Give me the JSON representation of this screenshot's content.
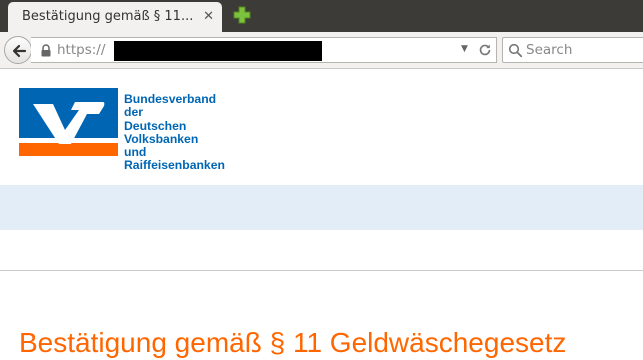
{
  "browser": {
    "tab_title": "Bestätigung gemäß § 11...",
    "tab_close": "✕",
    "url_prefix": "https://",
    "search_placeholder": "Search"
  },
  "page": {
    "org_name_lines": [
      "Bundesverband",
      "der",
      "Deutschen",
      "Volksbanken",
      "und",
      "Raiffeisenbanken"
    ],
    "heading": "Bestätigung gemäß § 11 Geldwäschegesetz"
  },
  "colors": {
    "brand_blue": "#0066b3",
    "brand_orange": "#ff6600",
    "nav_band": "#e3edf7"
  }
}
